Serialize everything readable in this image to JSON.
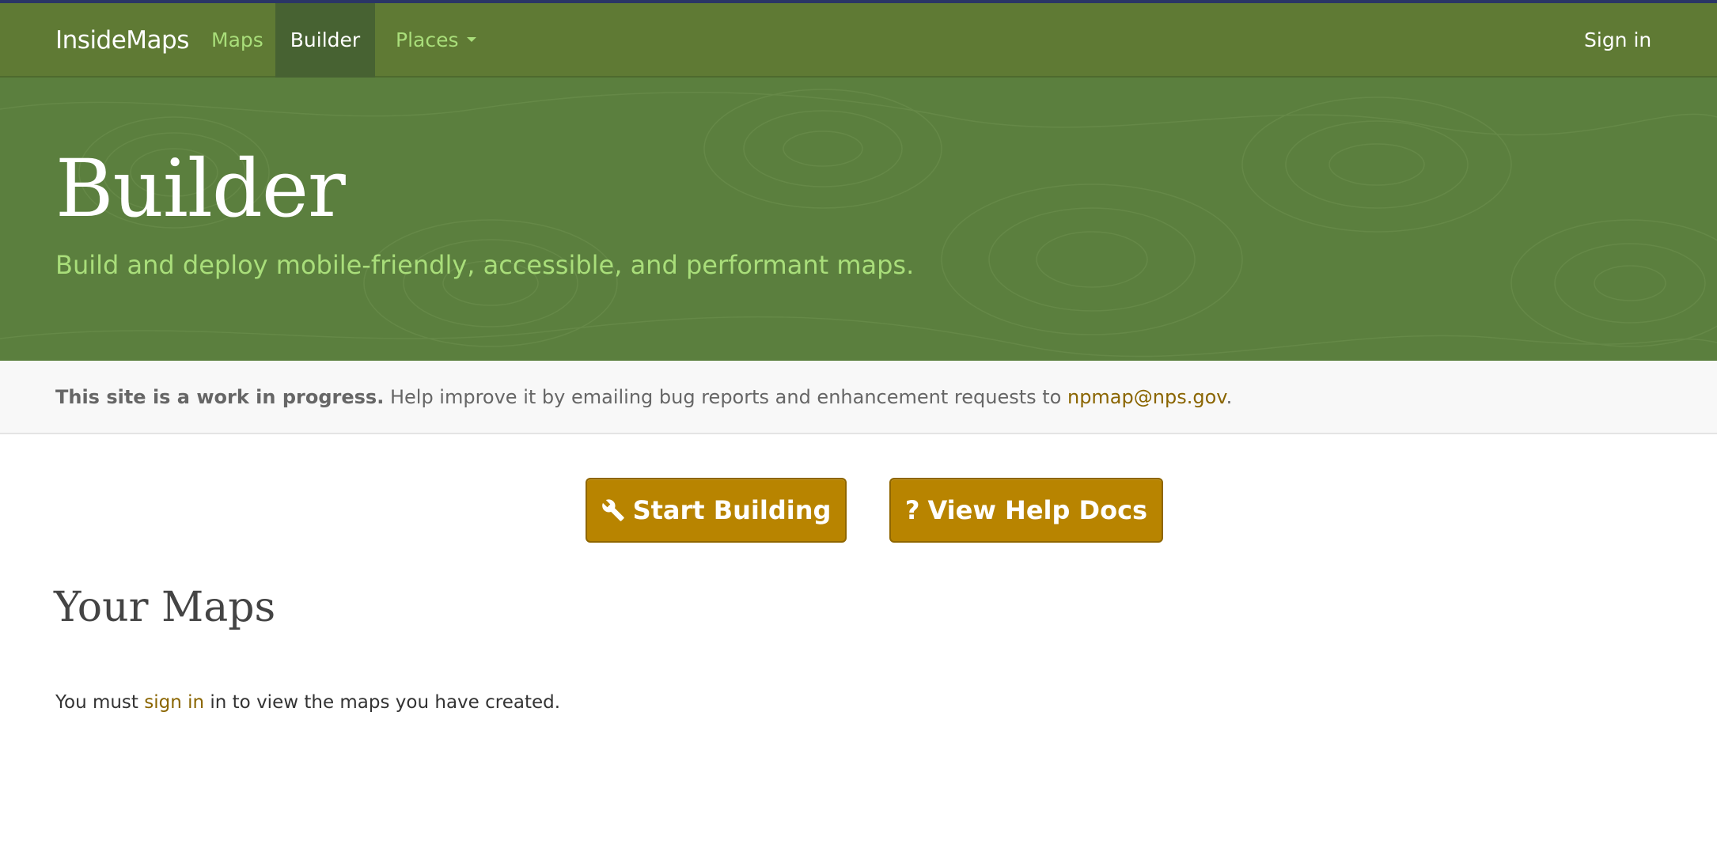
{
  "nav": {
    "brand": "InsideMaps",
    "items": [
      {
        "label": "Maps",
        "active": false
      },
      {
        "label": "Builder",
        "active": true
      },
      {
        "label": "Places",
        "active": false,
        "dropdown": true
      }
    ],
    "signin_label": "Sign in"
  },
  "hero": {
    "title": "Builder",
    "subtitle": "Build and deploy mobile-friendly, accessible, and performant maps."
  },
  "notice": {
    "strong": "This site is a work in progress.",
    "text": " Help improve it by emailing bug reports and enhancement requests to ",
    "email": "npmap@nps.gov",
    "end": "."
  },
  "actions": {
    "start_label": "Start Building",
    "help_mark": "?",
    "help_label": "View Help Docs"
  },
  "maps": {
    "title": "Your Maps",
    "msg_prefix": "You must ",
    "msg_link": "sign in",
    "msg_suffix": " in to view the maps you have created."
  },
  "colors": {
    "navbar": "#5f7a34",
    "hero": "#5b7f3e",
    "accent_green": "#a9de7a",
    "button": "#b88400",
    "link": "#8a6500"
  },
  "icons": {
    "start_button": "wrench-icon",
    "places_dropdown": "caret-down-icon"
  }
}
